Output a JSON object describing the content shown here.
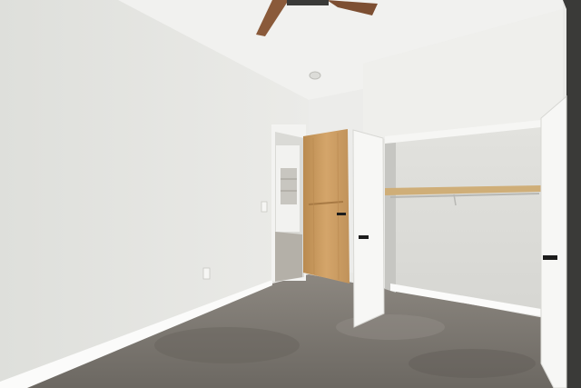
{
  "photo": {
    "subject": "empty-bedroom-interior",
    "palette": {
      "wall_left": "#e4e4e0",
      "wall_back": "#ececea",
      "ceiling": "#f2f2f0",
      "floor": "#7a7670",
      "wood_door": "#c79a5d",
      "white_door": "#f7f7f5",
      "closet_interior": "#dcdcd8",
      "shelf_wood": "#cfae78",
      "fan_blade": "#8a5a3a",
      "handle": "#1c1c1c"
    }
  }
}
